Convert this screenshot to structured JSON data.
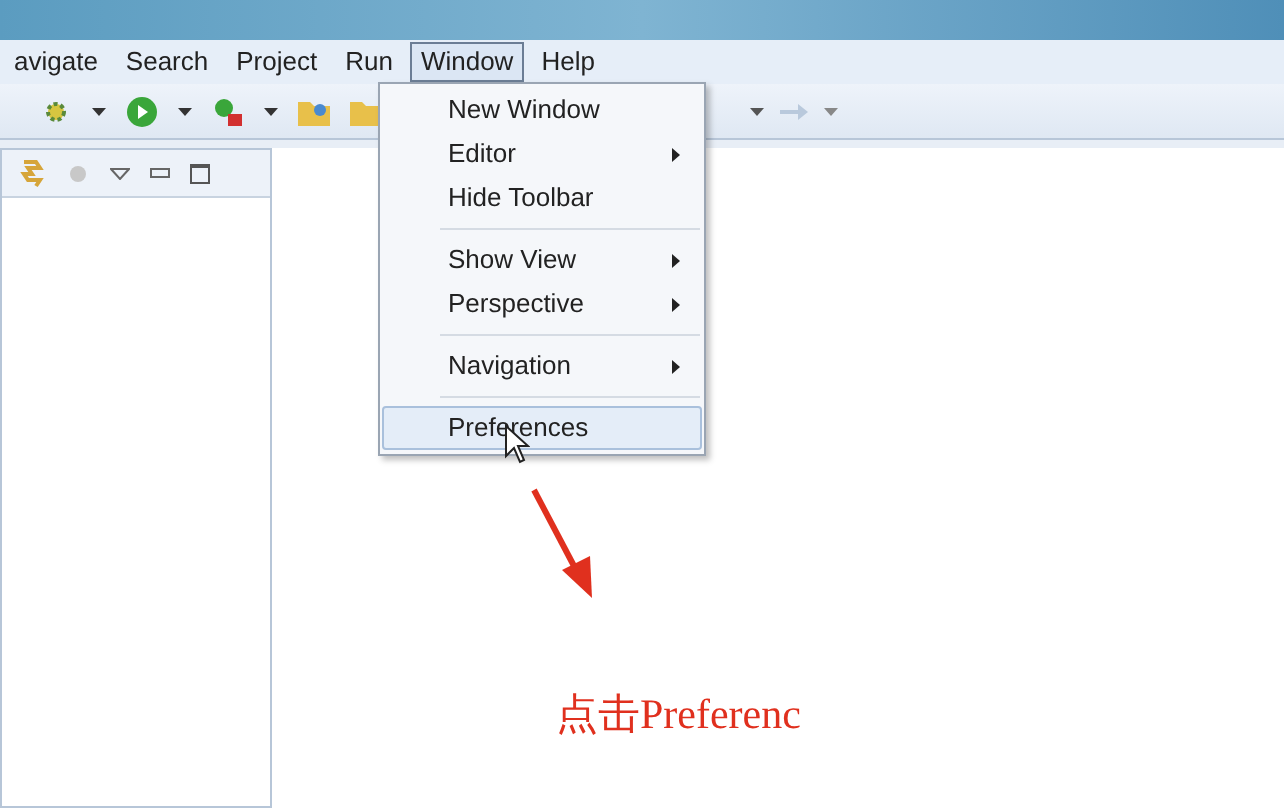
{
  "menu_bar": [
    {
      "label": "avigate",
      "selected": false
    },
    {
      "label": "Search",
      "selected": false
    },
    {
      "label": "Project",
      "selected": false
    },
    {
      "label": "Run",
      "selected": false
    },
    {
      "label": "Window",
      "selected": true
    },
    {
      "label": "Help",
      "selected": false
    }
  ],
  "window_menu": {
    "groups": [
      [
        {
          "label": "New Window",
          "has_submenu": false,
          "selected": false
        },
        {
          "label": "Editor",
          "has_submenu": true,
          "selected": false
        },
        {
          "label": "Hide Toolbar",
          "has_submenu": false,
          "selected": false
        }
      ],
      [
        {
          "label": "Show View",
          "has_submenu": true,
          "selected": false
        },
        {
          "label": "Perspective",
          "has_submenu": true,
          "selected": false
        }
      ],
      [
        {
          "label": "Navigation",
          "has_submenu": true,
          "selected": false
        }
      ],
      [
        {
          "label": "Preferences",
          "has_submenu": false,
          "selected": true
        }
      ]
    ]
  },
  "annotation": {
    "text": "点击Preferenc"
  }
}
